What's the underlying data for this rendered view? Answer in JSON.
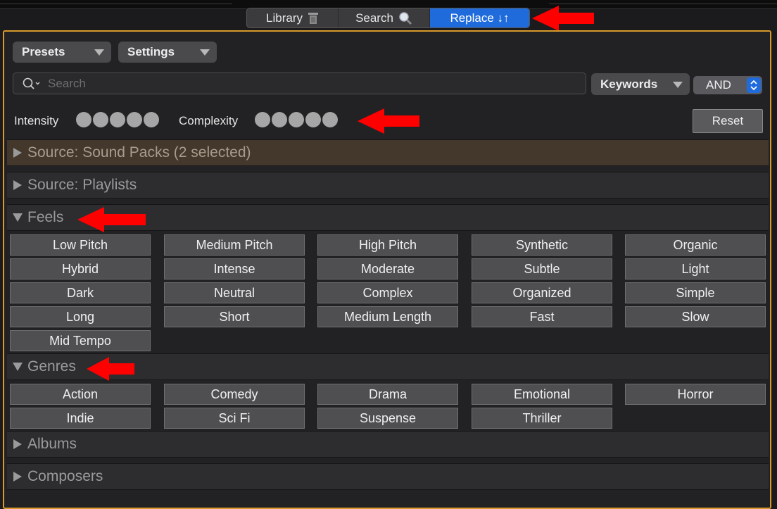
{
  "tabs": [
    {
      "label": "Library",
      "icon": "trash-icon"
    },
    {
      "label": "Search",
      "icon": "magnifier-icon"
    },
    {
      "label": "Replace ↓↑",
      "icon": "",
      "active": true
    }
  ],
  "toolbar": {
    "presets_label": "Presets",
    "settings_label": "Settings",
    "search_placeholder": "Search",
    "search_value": "",
    "keywords_label": "Keywords",
    "logic_value": "AND",
    "reset_label": "Reset"
  },
  "meters": {
    "intensity_label": "Intensity",
    "intensity_level": 0,
    "complexity_label": "Complexity",
    "complexity_level": 0
  },
  "sections": {
    "sound_packs": "Source: Sound Packs (2 selected)",
    "playlists": "Source: Playlists",
    "feels": "Feels",
    "genres": "Genres",
    "albums": "Albums",
    "composers": "Composers"
  },
  "feels": [
    "Low Pitch",
    "Medium Pitch",
    "High Pitch",
    "Synthetic",
    "Organic",
    "Hybrid",
    "Intense",
    "Moderate",
    "Subtle",
    "Light",
    "Dark",
    "Neutral",
    "Complex",
    "Organized",
    "Simple",
    "Long",
    "Short",
    "Medium Length",
    "Fast",
    "Slow",
    "Mid Tempo"
  ],
  "genres": [
    "Action",
    "Comedy",
    "Drama",
    "Emotional",
    "Horror",
    "Indie",
    "Sci Fi",
    "Suspense",
    "Thriller"
  ],
  "colors": {
    "accent": "#1f6bdc",
    "panel_border": "#d99a2b",
    "annotation_arrow": "#ff0000",
    "selected_section": "#44382c"
  }
}
